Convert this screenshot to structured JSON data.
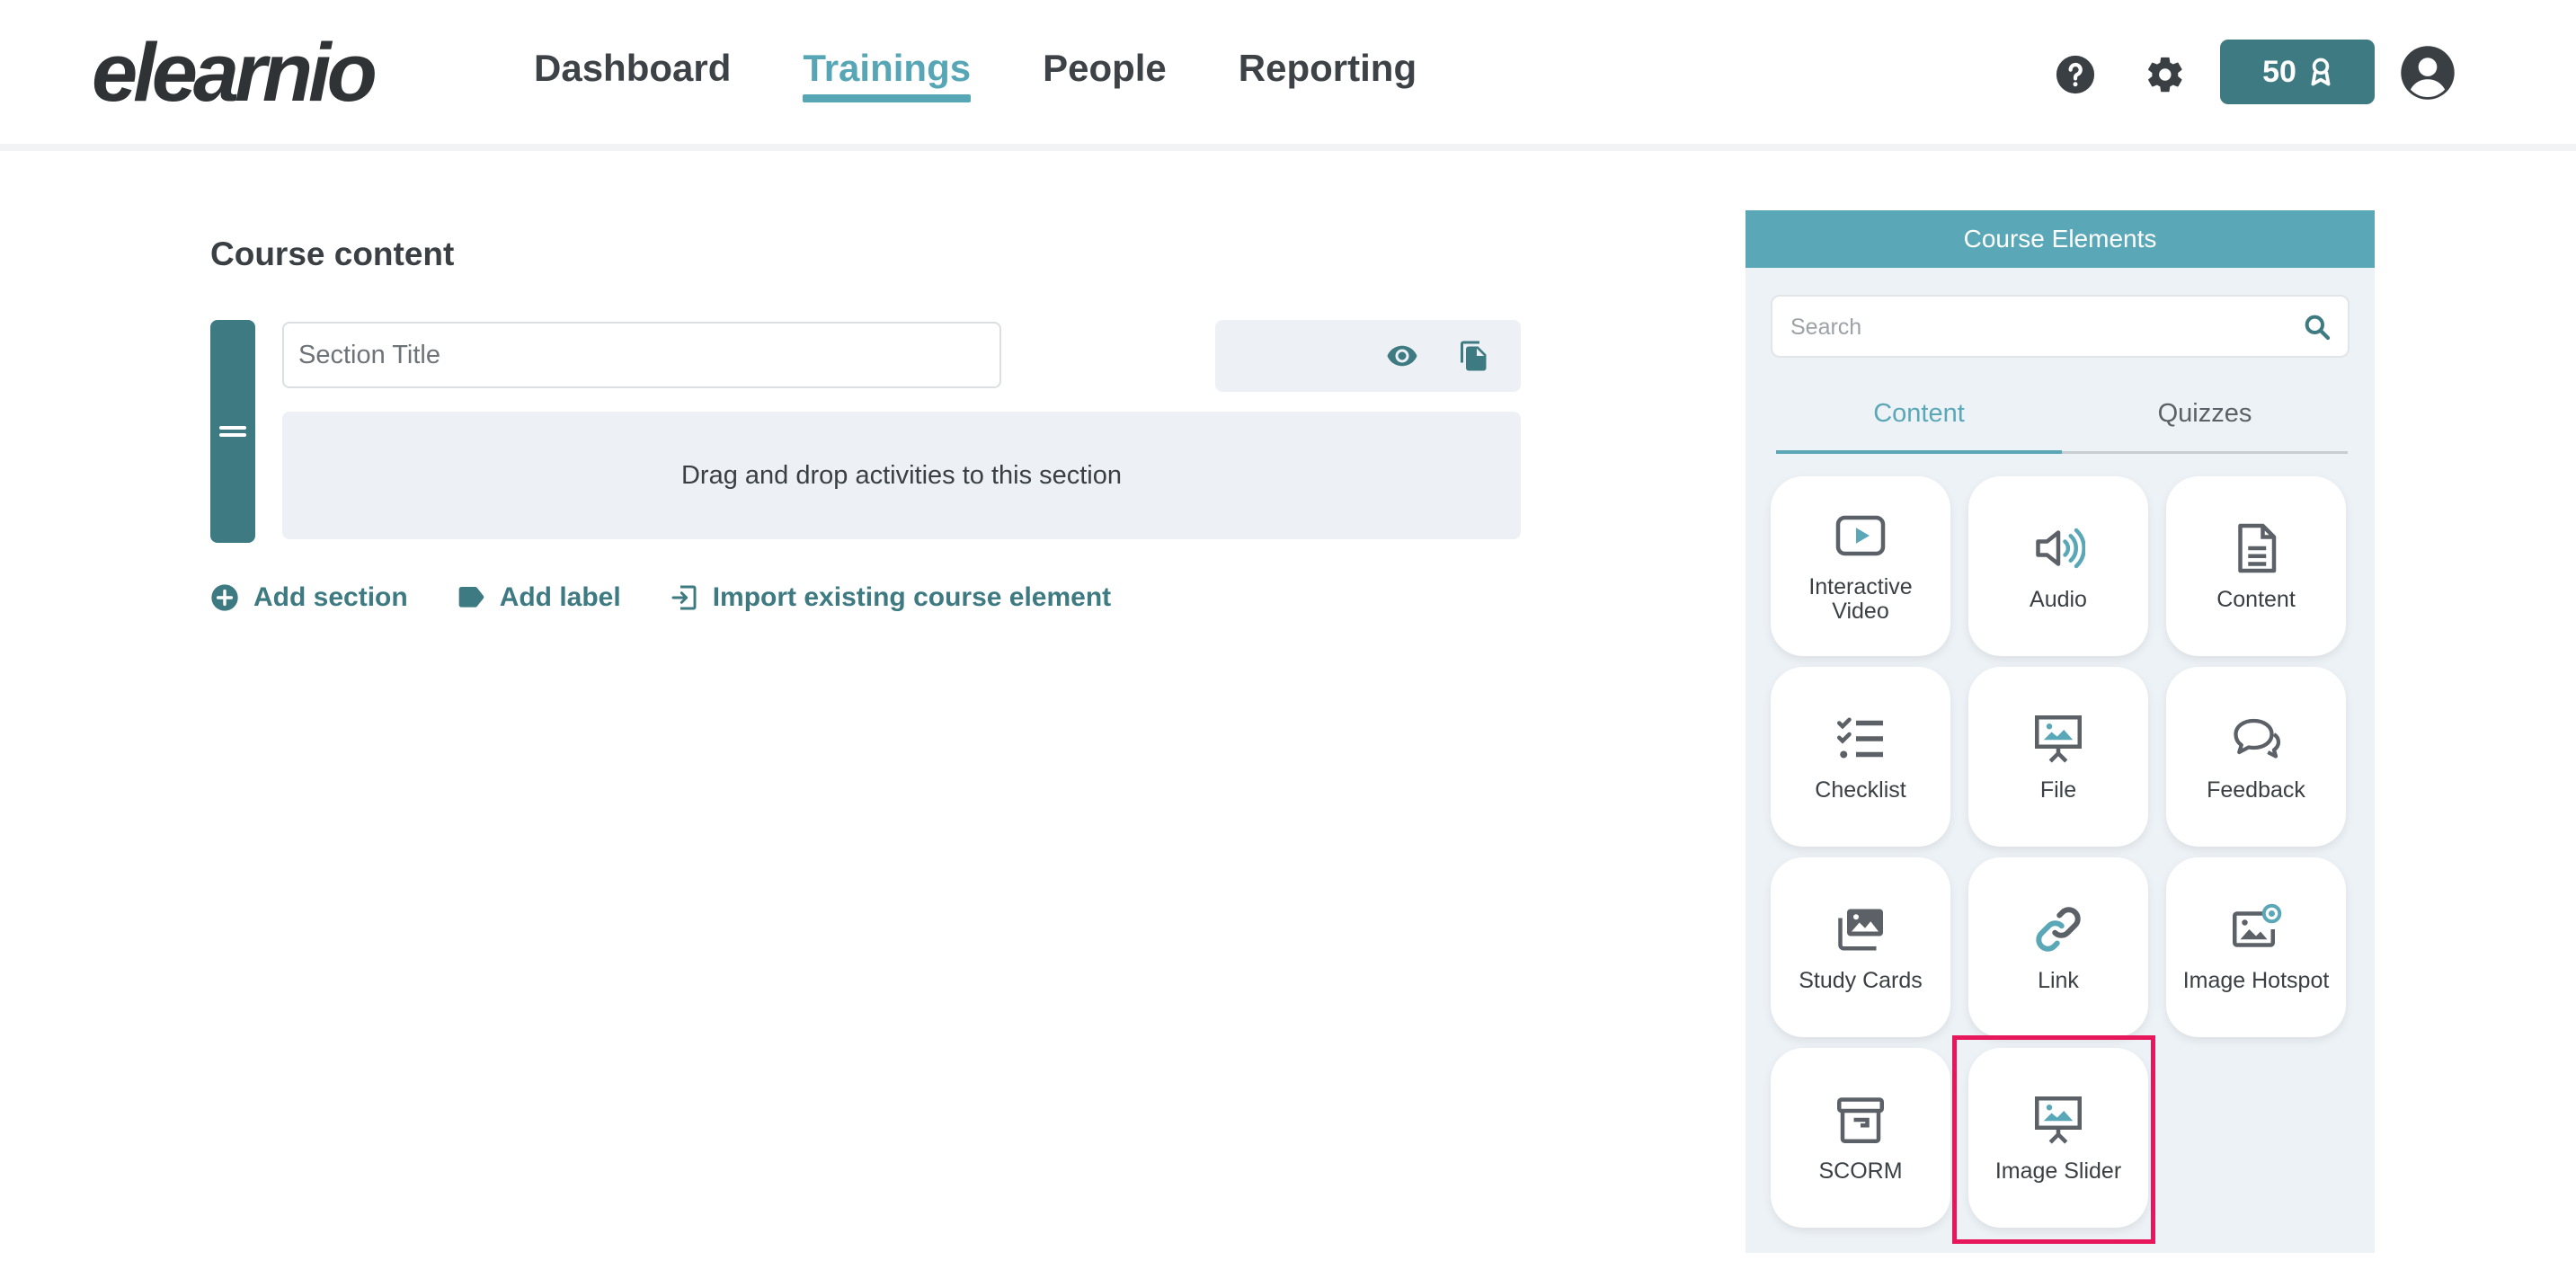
{
  "header": {
    "logo": "elearnio",
    "nav": [
      {
        "label": "Dashboard",
        "active": false
      },
      {
        "label": "Trainings",
        "active": true
      },
      {
        "label": "People",
        "active": false
      },
      {
        "label": "Reporting",
        "active": false
      }
    ],
    "credits": "50"
  },
  "main": {
    "title": "Course content",
    "section_placeholder": "Section Title",
    "drop_text": "Drag and drop activities to this section",
    "actions": {
      "add_section": "Add section",
      "add_label": "Add label",
      "import": "Import existing course element"
    }
  },
  "panel": {
    "title": "Course Elements",
    "search_placeholder": "Search",
    "tabs": [
      {
        "label": "Content",
        "active": true
      },
      {
        "label": "Quizzes",
        "active": false
      }
    ],
    "elements": [
      {
        "label": "Interactive Video",
        "icon": "play-icon"
      },
      {
        "label": "Audio",
        "icon": "speaker-icon"
      },
      {
        "label": "Content",
        "icon": "document-icon"
      },
      {
        "label": "Checklist",
        "icon": "checklist-icon"
      },
      {
        "label": "File",
        "icon": "presentation-icon"
      },
      {
        "label": "Feedback",
        "icon": "chat-icon"
      },
      {
        "label": "Study Cards",
        "icon": "images-icon"
      },
      {
        "label": "Link",
        "icon": "link-icon"
      },
      {
        "label": "Image Hotspot",
        "icon": "image-hotspot-icon"
      },
      {
        "label": "SCORM",
        "icon": "archive-icon"
      },
      {
        "label": "Image Slider",
        "icon": "presentation-icon"
      }
    ]
  },
  "colors": {
    "primary": "#3e7a82",
    "accent": "#5aa8b7",
    "highlight": "#e6175a"
  }
}
